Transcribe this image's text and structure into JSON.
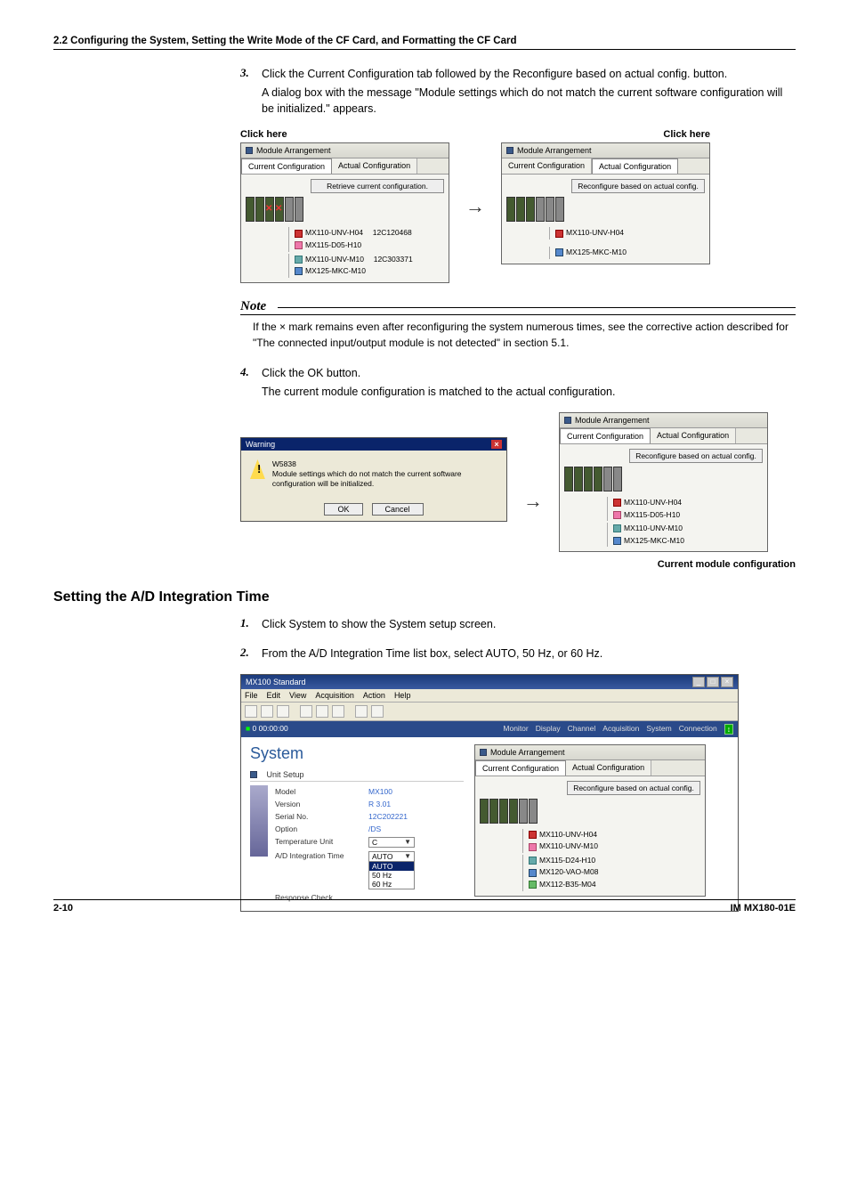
{
  "header": "2.2  Configuring the System, Setting the Write Mode of the CF Card, and Formatting the CF Card",
  "step3": {
    "num": "3.",
    "text": "Click the Current Configuration tab followed by the Reconfigure based on actual config. button.",
    "sub": "A dialog box with the message \"Module settings which do not match the current software configuration will be initialized.\" appears."
  },
  "clickHere": "Click here",
  "panel": {
    "title": "Module Arrangement",
    "tabCurrent": "Current Configuration",
    "tabActual": "Actual Configuration",
    "btnRetrieve": "Retrieve current configuration.",
    "btnReconfig": "Reconfigure based on actual config.",
    "mods": {
      "m1": "MX110-UNV-H04",
      "m1s": "12C120468",
      "m2": "MX115-D05-H10",
      "m3": "MX110-UNV-M10",
      "m3s": "12C303371",
      "m4": "MX125-MKC-M10"
    }
  },
  "note": {
    "title": "Note",
    "body": "If the × mark remains even after reconfiguring the system numerous times, see the corrective action described for \"The connected input/output module is not detected\" in section 5.1."
  },
  "step4": {
    "num": "4.",
    "text": "Click the OK button.",
    "sub": "The current module configuration is matched to the actual configuration."
  },
  "warnDlg": {
    "title": "Warning",
    "code": "W5838",
    "msg": "Module settings which do not match the current software configuration will be initialized.",
    "ok": "OK",
    "cancel": "Cancel"
  },
  "caption": "Current module configuration",
  "heading2": "Setting the A/D Integration Time",
  "step1": {
    "num": "1.",
    "text": "Click System to show the System setup screen."
  },
  "step2": {
    "num": "2.",
    "text": "From the A/D Integration Time list box, select AUTO, 50 Hz, or 60 Hz."
  },
  "app": {
    "title": "MX100 Standard",
    "menus": [
      "File",
      "Edit",
      "View",
      "Acquisition",
      "Action",
      "Help"
    ],
    "timer": "0 00:00:00",
    "navs": [
      "Monitor",
      "Display",
      "Channel",
      "Acquisition",
      "System",
      "Connection"
    ],
    "sysTitle": "System",
    "unitSetup": "Unit Setup",
    "modArr": "Module Arrangement",
    "rows": {
      "model": {
        "k": "Model",
        "v": "MX100"
      },
      "version": {
        "k": "Version",
        "v": "R 3.01"
      },
      "serial": {
        "k": "Serial No.",
        "v": "12C202221"
      },
      "option": {
        "k": "Option",
        "v": "/DS"
      },
      "temp": {
        "k": "Temperature Unit",
        "v": "C"
      },
      "ad": {
        "k": "A/D Integration Time",
        "v": "AUTO"
      },
      "resp": {
        "k": "Response Check"
      }
    },
    "adOpts": [
      "AUTO",
      "50 Hz",
      "60 Hz"
    ],
    "rmods": {
      "m1": "MX110-UNV-H04",
      "m2": "MX110-UNV-M10",
      "m3": "MX115-D24-H10",
      "m4": "MX120-VAO-M08",
      "m5": "MX112-B35-M04"
    }
  },
  "footer": {
    "left": "2-10",
    "right": "IM MX180-01E"
  }
}
